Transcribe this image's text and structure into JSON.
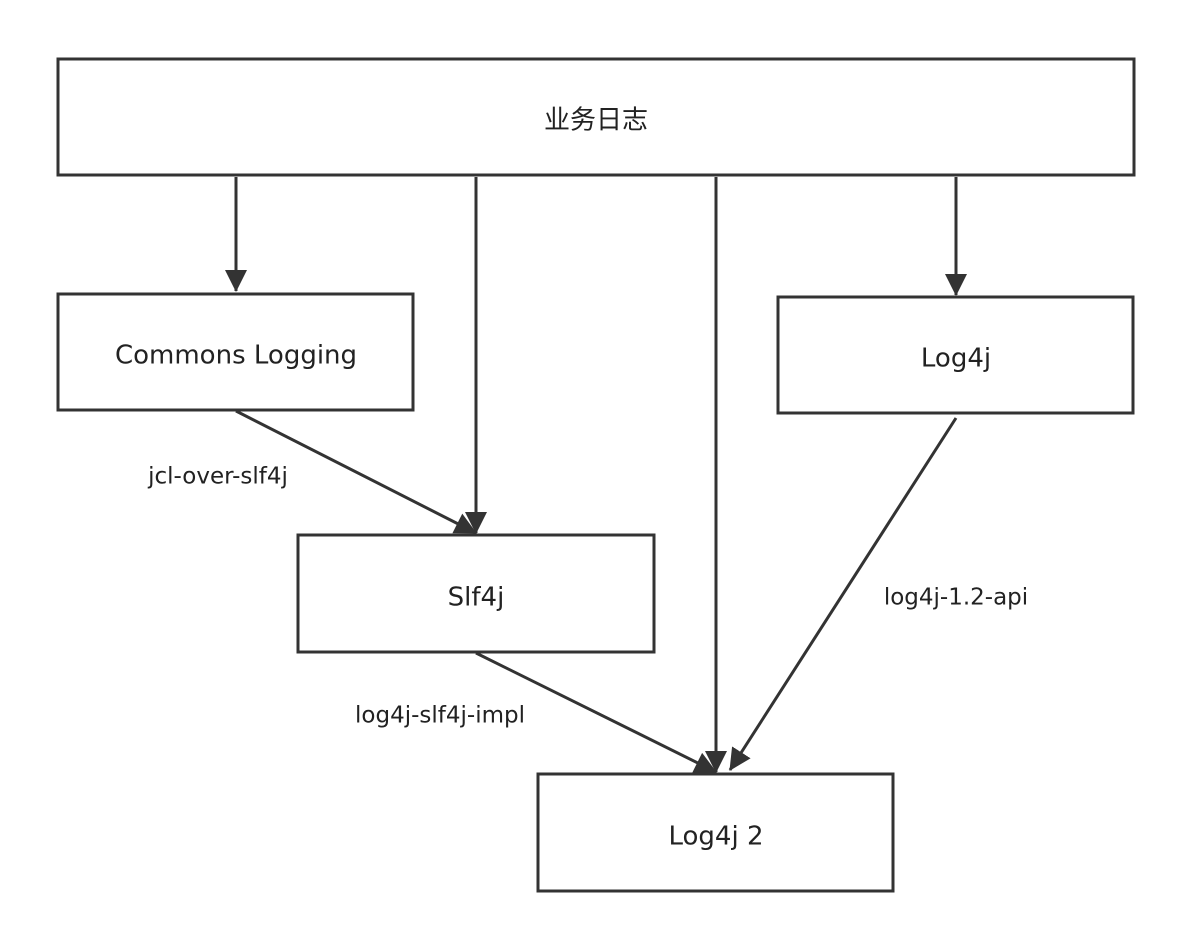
{
  "diagram": {
    "nodes": {
      "business_log": "业务日志",
      "commons_logging": "Commons Logging",
      "log4j": "Log4j",
      "slf4j": "Slf4j",
      "log4j2": "Log4j 2"
    },
    "edge_labels": {
      "jcl_over_slf4j": "jcl-over-slf4j",
      "log4j_slf4j_impl": "log4j-slf4j-impl",
      "log4j_1_2_api": "log4j-1.2-api"
    },
    "colors": {
      "stroke": "#333333",
      "text": "#222222",
      "background": "#ffffff"
    }
  }
}
